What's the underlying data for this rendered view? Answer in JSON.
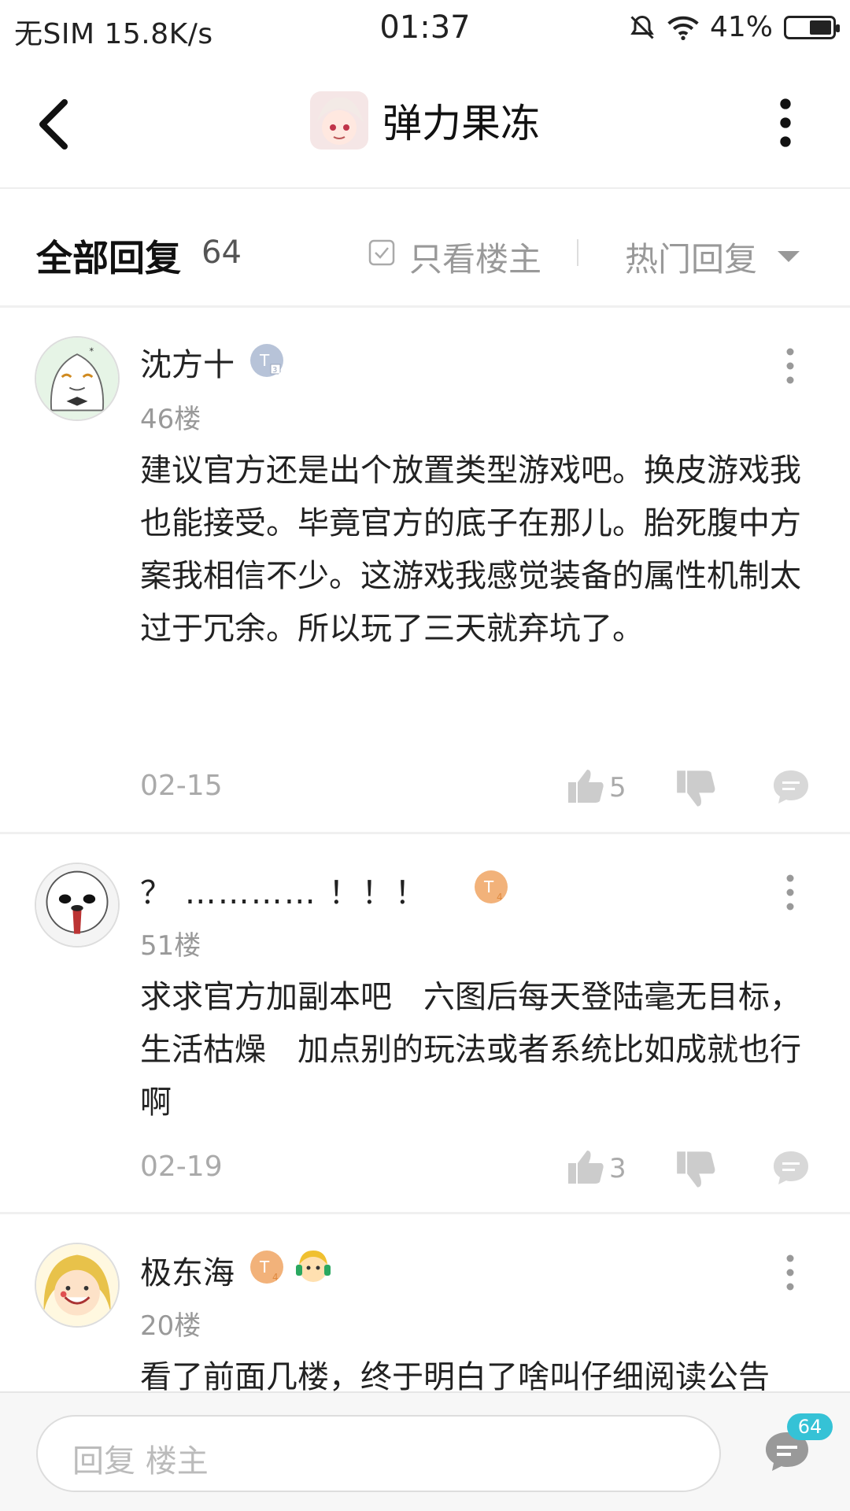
{
  "status_bar": {
    "carrier": "无SIM",
    "speed": "15.8K/s",
    "time": "01:37",
    "battery": "41%"
  },
  "header": {
    "title": "弹力果冻",
    "back_icon": "chevron-left-icon",
    "more_icon": "more-vertical-icon"
  },
  "reply_header": {
    "title": "全部回复",
    "count": "64",
    "filter_label": "只看楼主",
    "sort_label": "热门回复"
  },
  "comments": [
    {
      "username": "沈方十",
      "badge": "T3",
      "floor": "46楼",
      "text": "建议官方还是出个放置类型游戏吧。换皮游戏我也能接受。毕竟官方的底子在那儿。胎死腹中方案我相信不少。这游戏我感觉装备的属性机制太过于冗余。所以玩了三天就弃坑了。",
      "date": "02-15",
      "likes": "5"
    },
    {
      "username": "？ ………… ！！！",
      "badge": "T4",
      "floor": "51楼",
      "text": "求求官方加副本吧　六图后每天登陆毫无目标，生活枯燥　加点别的玩法或者系统比如成就也行啊",
      "date": "02-19",
      "likes": "3"
    },
    {
      "username": "极东海",
      "badge": "T4",
      "floor": "20楼",
      "text": "看了前面几楼，终于明白了啥叫仔细阅读公告"
    }
  ],
  "bottom_bar": {
    "placeholder": "回复  楼主",
    "comment_count": "64"
  },
  "colors": {
    "accent": "#35c2d6",
    "badge_blue": "#b7c3d8",
    "badge_orange": "#f2b27a"
  }
}
